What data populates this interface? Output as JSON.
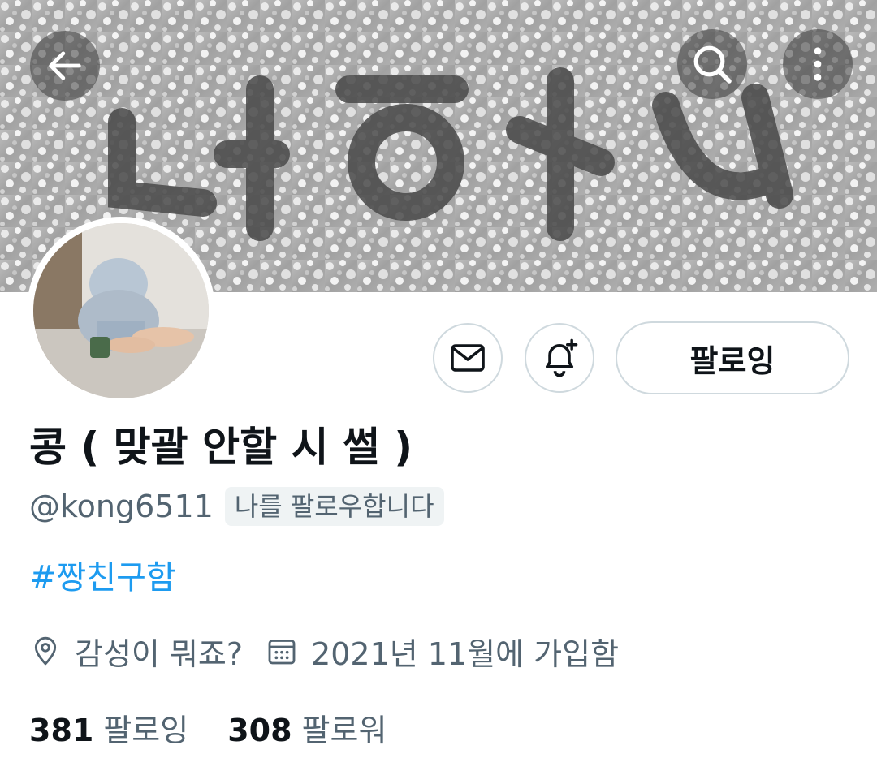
{
  "profile": {
    "display_name": "콩 ( 맞괄 안할 시 썰 )",
    "handle": "@kong6511",
    "follows_you": "나를 팔로우합니다",
    "bio_hashtag": "#짱친구함",
    "location": "감성이 뭐죠?",
    "joined": "2021년 11월에 가입함",
    "following_count": "381",
    "following_label": "팔로잉",
    "followers_count": "308",
    "followers_label": "팔로워"
  },
  "actions": {
    "following_button_label": "팔로잉"
  },
  "icons": {
    "back": "arrow-left-icon",
    "search": "search-icon",
    "more": "more-vertical-icon",
    "message": "mail-icon",
    "notify": "bell-plus-icon",
    "location": "location-pin-icon",
    "calendar": "calendar-icon"
  },
  "colors": {
    "accent": "#1d9bf0",
    "secondary_text": "#536471",
    "primary_text": "#0f1419",
    "border": "#cfd9de"
  }
}
